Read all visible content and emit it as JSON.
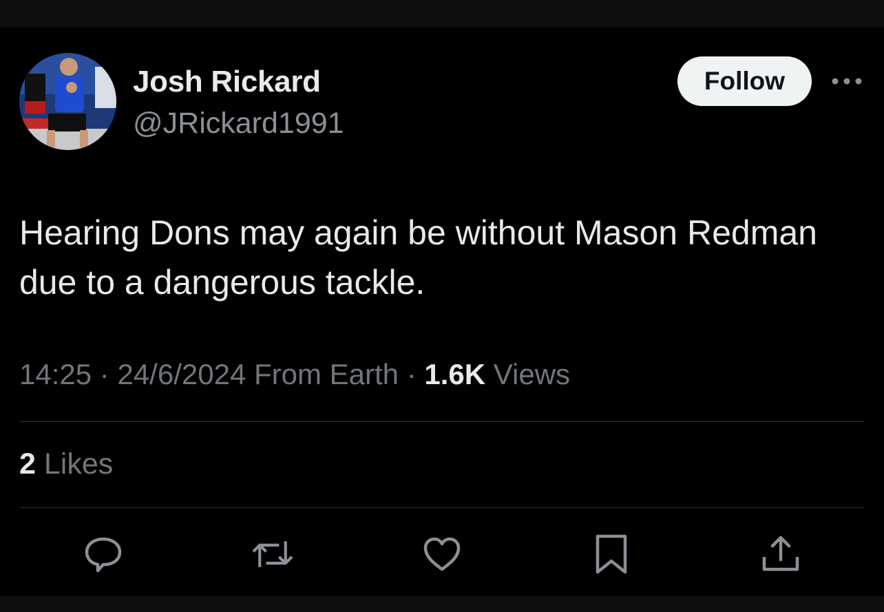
{
  "tweet": {
    "author": {
      "name": "Josh Rickard",
      "handle": "@JRickard1991",
      "avatar_icon": "profile-photo"
    },
    "follow_label": "Follow",
    "more_icon": "more-dots-icon",
    "text": "Hearing Dons may again be without Mason Redman due to a dangerous tackle.",
    "meta": {
      "time": "14:25",
      "separator": "·",
      "date": "24/6/2024",
      "source": "From Earth",
      "views_count": "1.6K",
      "views_label": "Views"
    },
    "likes": {
      "count": "2",
      "label": "Likes"
    },
    "actions": [
      {
        "icon": "reply-icon"
      },
      {
        "icon": "retweet-icon"
      },
      {
        "icon": "like-heart-icon"
      },
      {
        "icon": "bookmark-icon"
      },
      {
        "icon": "share-icon"
      }
    ]
  },
  "colors": {
    "background": "#000000",
    "text_primary": "#e7e9ea",
    "text_secondary": "#71767b",
    "divider": "#2f3336",
    "follow_bg": "#eff3f4",
    "follow_text": "#0f1419",
    "icon": "#8b9096"
  }
}
